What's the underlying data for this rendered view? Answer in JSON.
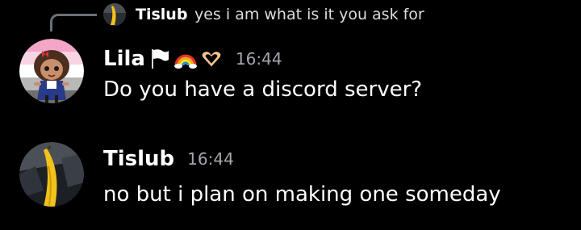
{
  "reply": {
    "author": "Tislub",
    "text": "yes i am what is it you ask for",
    "avatar_icon": "banana-avatar-icon"
  },
  "messages": [
    {
      "author": "Lila",
      "badges": [
        "white-flag-icon",
        "rainbow-icon",
        "heart-hands-icon"
      ],
      "timestamp": "16:44",
      "content": "Do you have a discord server?",
      "avatar_icon": "cartoon-girl-avatar-icon"
    },
    {
      "author": "Tislub",
      "timestamp": "16:44",
      "content": "no but i plan on making one someday",
      "avatar_icon": "banana-avatar-icon"
    }
  ],
  "colors": {
    "background": "#000000",
    "text": "#ffffff",
    "muted": "#a3a6ad",
    "connector": "#6b6f76"
  }
}
